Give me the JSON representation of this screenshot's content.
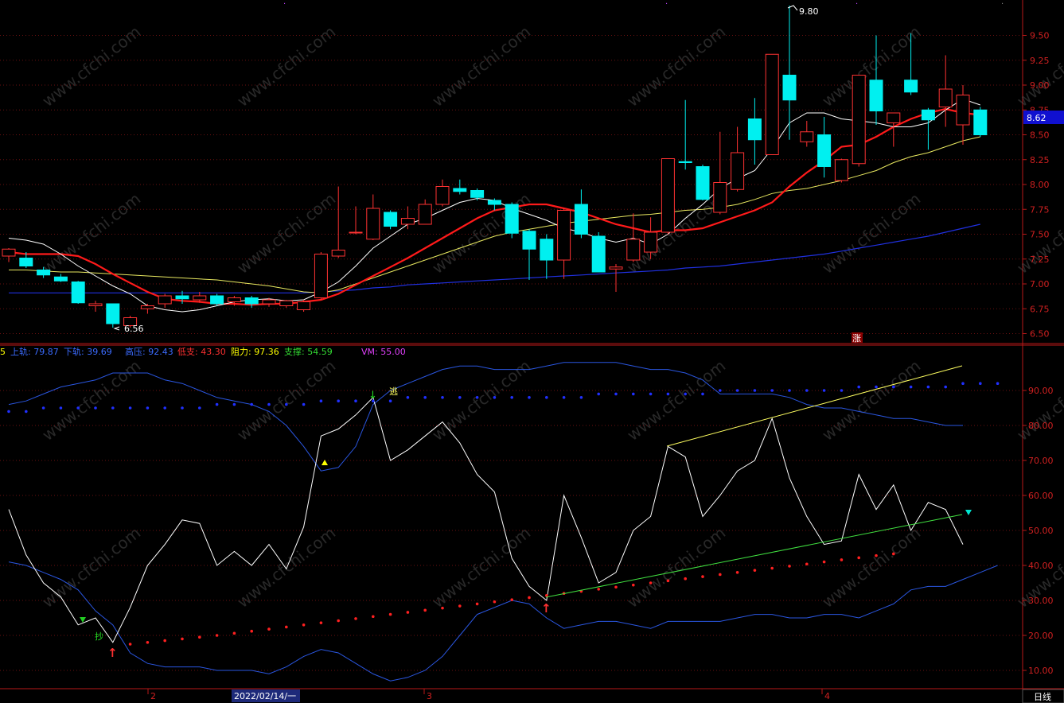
{
  "chart_data": [
    {
      "type": "candlestick",
      "title": "",
      "ylim": [
        6.4,
        9.65
      ],
      "y_ticks": [
        "9.50",
        "9.25",
        "9.00",
        "8.75",
        "8.50",
        "8.25",
        "8.00",
        "7.75",
        "7.50",
        "7.25",
        "7.00",
        "6.75",
        "6.50"
      ],
      "current_price": "8.62",
      "annotations": {
        "high": "9.80",
        "low": "6.56",
        "mark": "涨"
      },
      "candles": [
        {
          "o": 7.28,
          "h": 7.36,
          "l": 7.22,
          "c": 7.35
        },
        {
          "o": 7.26,
          "h": 7.32,
          "l": 7.16,
          "c": 7.18
        },
        {
          "o": 7.14,
          "h": 7.17,
          "l": 7.06,
          "c": 7.09
        },
        {
          "o": 7.07,
          "h": 7.1,
          "l": 7.02,
          "c": 7.03
        },
        {
          "o": 7.02,
          "h": 7.03,
          "l": 6.8,
          "c": 6.81
        },
        {
          "o": 6.78,
          "h": 6.83,
          "l": 6.72,
          "c": 6.8
        },
        {
          "o": 6.8,
          "h": 6.8,
          "l": 6.56,
          "c": 6.6
        },
        {
          "o": 6.58,
          "h": 6.68,
          "l": 6.56,
          "c": 6.66
        },
        {
          "o": 6.75,
          "h": 6.8,
          "l": 6.7,
          "c": 6.78
        },
        {
          "o": 6.8,
          "h": 6.9,
          "l": 6.76,
          "c": 6.88
        },
        {
          "o": 6.88,
          "h": 6.93,
          "l": 6.8,
          "c": 6.85
        },
        {
          "o": 6.84,
          "h": 6.92,
          "l": 6.81,
          "c": 6.88
        },
        {
          "o": 6.88,
          "h": 6.9,
          "l": 6.78,
          "c": 6.8
        },
        {
          "o": 6.82,
          "h": 6.88,
          "l": 6.78,
          "c": 6.86
        },
        {
          "o": 6.86,
          "h": 6.88,
          "l": 6.76,
          "c": 6.8
        },
        {
          "o": 6.8,
          "h": 6.86,
          "l": 6.77,
          "c": 6.84
        },
        {
          "o": 6.78,
          "h": 6.84,
          "l": 6.76,
          "c": 6.83
        },
        {
          "o": 6.74,
          "h": 6.84,
          "l": 6.72,
          "c": 6.82
        },
        {
          "o": 6.86,
          "h": 7.32,
          "l": 6.84,
          "c": 7.3
        },
        {
          "o": 7.28,
          "h": 7.98,
          "l": 7.26,
          "c": 7.34
        },
        {
          "o": 7.52,
          "h": 7.78,
          "l": 7.5,
          "c": 7.52
        },
        {
          "o": 7.45,
          "h": 7.9,
          "l": 7.44,
          "c": 7.76
        },
        {
          "o": 7.72,
          "h": 7.74,
          "l": 7.55,
          "c": 7.58
        },
        {
          "o": 7.6,
          "h": 7.78,
          "l": 7.55,
          "c": 7.66
        },
        {
          "o": 7.6,
          "h": 7.85,
          "l": 7.6,
          "c": 7.8
        },
        {
          "o": 7.8,
          "h": 8.05,
          "l": 7.78,
          "c": 7.98
        },
        {
          "o": 7.96,
          "h": 8.05,
          "l": 7.9,
          "c": 7.93
        },
        {
          "o": 7.94,
          "h": 7.96,
          "l": 7.84,
          "c": 7.87
        },
        {
          "o": 7.84,
          "h": 7.86,
          "l": 7.74,
          "c": 7.8
        },
        {
          "o": 7.8,
          "h": 7.82,
          "l": 7.46,
          "c": 7.51
        },
        {
          "o": 7.53,
          "h": 7.55,
          "l": 7.04,
          "c": 7.35
        },
        {
          "o": 7.45,
          "h": 7.5,
          "l": 7.05,
          "c": 7.24
        },
        {
          "o": 7.24,
          "h": 7.76,
          "l": 7.05,
          "c": 7.74
        },
        {
          "o": 7.8,
          "h": 7.95,
          "l": 7.46,
          "c": 7.5
        },
        {
          "o": 7.48,
          "h": 7.52,
          "l": 7.12,
          "c": 7.12
        },
        {
          "o": 7.15,
          "h": 7.2,
          "l": 6.92,
          "c": 7.17
        },
        {
          "o": 7.24,
          "h": 7.71,
          "l": 7.22,
          "c": 7.45
        },
        {
          "o": 7.32,
          "h": 7.67,
          "l": 7.25,
          "c": 7.52
        },
        {
          "o": 7.52,
          "h": 8.26,
          "l": 7.5,
          "c": 8.26
        },
        {
          "o": 8.23,
          "h": 8.85,
          "l": 8.15,
          "c": 8.22
        },
        {
          "o": 8.18,
          "h": 8.2,
          "l": 7.84,
          "c": 7.85
        },
        {
          "o": 7.72,
          "h": 8.53,
          "l": 7.7,
          "c": 8.02
        },
        {
          "o": 7.95,
          "h": 8.58,
          "l": 7.93,
          "c": 8.32
        },
        {
          "o": 8.66,
          "h": 8.87,
          "l": 8.2,
          "c": 8.45
        },
        {
          "o": 8.3,
          "h": 9.31,
          "l": 8.3,
          "c": 9.31
        },
        {
          "o": 9.1,
          "h": 9.8,
          "l": 8.45,
          "c": 8.85
        },
        {
          "o": 8.43,
          "h": 8.64,
          "l": 8.38,
          "c": 8.53
        },
        {
          "o": 8.5,
          "h": 8.68,
          "l": 8.07,
          "c": 8.18
        },
        {
          "o": 8.04,
          "h": 8.26,
          "l": 8.02,
          "c": 8.25
        },
        {
          "o": 8.21,
          "h": 9.1,
          "l": 8.18,
          "c": 9.1
        },
        {
          "o": 9.05,
          "h": 9.5,
          "l": 8.6,
          "c": 8.74
        },
        {
          "o": 8.62,
          "h": 8.7,
          "l": 8.38,
          "c": 8.72
        },
        {
          "o": 9.05,
          "h": 9.52,
          "l": 8.9,
          "c": 8.93
        },
        {
          "o": 8.75,
          "h": 8.77,
          "l": 8.35,
          "c": 8.65
        },
        {
          "o": 8.78,
          "h": 9.3,
          "l": 8.58,
          "c": 8.96
        },
        {
          "o": 8.6,
          "h": 9.0,
          "l": 8.4,
          "c": 8.9
        },
        {
          "o": 8.75,
          "h": 8.78,
          "l": 8.48,
          "c": 8.5
        }
      ],
      "ma5": [
        7.46,
        7.44,
        7.4,
        7.3,
        7.18,
        7.08,
        6.98,
        6.9,
        6.78,
        6.74,
        6.72,
        6.74,
        6.78,
        6.82,
        6.84,
        6.85,
        6.83,
        6.84,
        6.92,
        7.02,
        7.18,
        7.36,
        7.48,
        7.6,
        7.66,
        7.74,
        7.82,
        7.86,
        7.84,
        7.76,
        7.7,
        7.64,
        7.56,
        7.52,
        7.46,
        7.42,
        7.46,
        7.4,
        7.5,
        7.66,
        7.8,
        7.96,
        8.06,
        8.14,
        8.36,
        8.62,
        8.72,
        8.72,
        8.66,
        8.64,
        8.62,
        8.58,
        8.58,
        8.62,
        8.75,
        8.86,
        8.8
      ],
      "ma10": [
        7.32,
        7.3,
        7.3,
        7.3,
        7.28,
        7.2,
        7.1,
        7.01,
        6.92,
        6.85,
        6.83,
        6.82,
        6.8,
        6.8,
        6.79,
        6.8,
        6.8,
        6.82,
        6.84,
        6.9,
        6.99,
        7.08,
        7.17,
        7.26,
        7.36,
        7.46,
        7.56,
        7.66,
        7.74,
        7.77,
        7.8,
        7.8,
        7.76,
        7.72,
        7.66,
        7.6,
        7.56,
        7.52,
        7.54,
        7.54,
        7.56,
        7.62,
        7.68,
        7.74,
        7.82,
        7.98,
        8.12,
        8.24,
        8.38,
        8.4,
        8.48,
        8.58,
        8.66,
        8.72,
        8.76,
        8.72,
        8.7
      ],
      "ma20": [
        7.14,
        7.14,
        7.13,
        7.12,
        7.12,
        7.11,
        7.1,
        7.09,
        7.08,
        7.07,
        7.06,
        7.05,
        7.04,
        7.02,
        7.0,
        6.98,
        6.95,
        6.92,
        6.91,
        6.94,
        7.0,
        7.06,
        7.12,
        7.18,
        7.24,
        7.3,
        7.36,
        7.42,
        7.48,
        7.52,
        7.55,
        7.58,
        7.61,
        7.63,
        7.65,
        7.67,
        7.69,
        7.7,
        7.72,
        7.74,
        7.75,
        7.77,
        7.8,
        7.85,
        7.91,
        7.94,
        7.96,
        8.0,
        8.04,
        8.09,
        8.14,
        8.22,
        8.28,
        8.32,
        8.38,
        8.44,
        8.48
      ],
      "ma60": [
        6.91,
        6.91,
        6.91,
        6.91,
        6.91,
        6.91,
        6.91,
        6.91,
        6.91,
        6.91,
        6.91,
        6.91,
        6.91,
        6.91,
        6.91,
        6.91,
        6.91,
        6.91,
        6.92,
        6.93,
        6.94,
        6.96,
        6.97,
        6.99,
        7.0,
        7.01,
        7.02,
        7.03,
        7.04,
        7.05,
        7.06,
        7.07,
        7.08,
        7.09,
        7.1,
        7.11,
        7.12,
        7.13,
        7.14,
        7.16,
        7.17,
        7.18,
        7.2,
        7.22,
        7.24,
        7.26,
        7.28,
        7.3,
        7.33,
        7.36,
        7.39,
        7.42,
        7.45,
        7.48,
        7.52,
        7.56,
        7.6
      ]
    },
    {
      "type": "line",
      "title": "",
      "ylim": [
        5,
        102
      ],
      "y_ticks": [
        "90.00",
        "80.00",
        "70.00",
        "60.00",
        "50.00",
        "40.00",
        "30.00",
        "20.00",
        "10.00"
      ],
      "legend": [
        {
          "label": "5",
          "color": "#ffff00"
        },
        {
          "label": "上轨: 79.87",
          "color": "#3b6bff"
        },
        {
          "label": "下轨: 39.69",
          "color": "#3b6bff"
        },
        {
          "label": "高压: 92.43",
          "color": "#3b6bff"
        },
        {
          "label": "低支: 43.30",
          "color": "#ff3030"
        },
        {
          "label": "阻力: 97.36",
          "color": "#ffff00"
        },
        {
          "label": "支撑: 54.59",
          "color": "#33dd33"
        },
        {
          "label": "VM: 55.00",
          "color": "#e040fb"
        }
      ],
      "signals": [
        "逃",
        "抄"
      ],
      "series": [
        {
          "values": [
            56,
            43,
            35,
            31,
            23,
            25,
            18,
            28,
            40,
            46,
            53,
            52,
            40,
            44,
            40,
            46,
            39,
            51,
            77,
            79,
            83,
            88,
            70,
            73,
            77,
            81,
            75,
            66,
            61,
            42,
            34,
            30,
            60,
            48,
            35,
            38,
            50,
            54,
            74,
            71,
            54,
            60,
            67,
            70,
            82,
            65,
            54,
            46,
            47,
            66,
            56,
            63,
            50,
            58,
            56,
            46
          ]
        },
        {
          "name": "上轨",
          "values": [
            86,
            87,
            89,
            91,
            92,
            93,
            95,
            95,
            95,
            93,
            92,
            90,
            88,
            87,
            86,
            84,
            80,
            74,
            67,
            68,
            74,
            86,
            90,
            92,
            94,
            96,
            97,
            97,
            96,
            96,
            96,
            97,
            98,
            98,
            98,
            98,
            97,
            96,
            96,
            95,
            93,
            89,
            89,
            89,
            89,
            88,
            86,
            85,
            85,
            84,
            83,
            82,
            82,
            81,
            80,
            80
          ]
        },
        {
          "name": "下轨",
          "values": [
            41,
            40,
            38,
            36,
            33,
            27,
            23,
            15,
            12,
            11,
            11,
            11,
            10,
            10,
            10,
            9,
            11,
            14,
            16,
            15,
            12,
            9,
            7,
            8,
            10,
            14,
            20,
            26,
            28,
            30,
            29,
            25,
            22,
            23,
            24,
            24,
            23,
            22,
            24,
            24,
            24,
            24,
            25,
            26,
            26,
            25,
            25,
            26,
            26,
            25,
            27,
            29,
            33,
            34,
            34,
            36,
            38,
            40
          ]
        },
        {
          "name": "高压",
          "values": [
            84,
            84,
            85,
            85,
            85,
            85,
            85,
            85,
            85,
            85,
            85,
            85,
            86,
            86,
            86,
            86,
            86,
            86,
            87,
            87,
            87,
            87,
            87,
            88,
            88,
            88,
            88,
            88,
            88,
            88,
            88,
            88,
            88,
            88,
            89,
            89,
            89,
            89,
            89,
            89,
            89,
            90,
            90,
            90,
            90,
            90,
            90,
            90,
            90,
            91,
            91,
            91,
            91,
            91,
            91,
            92,
            92,
            92
          ]
        },
        {
          "name": "低支",
          "values": [
            17.5,
            18,
            18.5,
            19,
            19.5,
            20,
            20.6,
            21.2,
            21.8,
            22.4,
            23,
            23.6,
            24.2,
            24.8,
            25.4,
            26,
            26.6,
            27.2,
            27.8,
            28.4,
            29,
            29.6,
            30.2,
            30.8,
            31.4,
            32,
            32.6,
            33.2,
            33.8,
            34.4,
            35,
            35.6,
            36.2,
            36.8,
            37.4,
            38,
            38.6,
            39.2,
            39.8,
            40.4,
            41,
            41.6,
            42.2,
            42.8,
            43.3
          ]
        }
      ]
    }
  ],
  "x_axis": {
    "labels": [
      "2",
      "2022/02/14/一",
      "3",
      "4"
    ]
  },
  "status": {
    "period": "日线"
  },
  "watermark_text": "www.cfchi.com"
}
